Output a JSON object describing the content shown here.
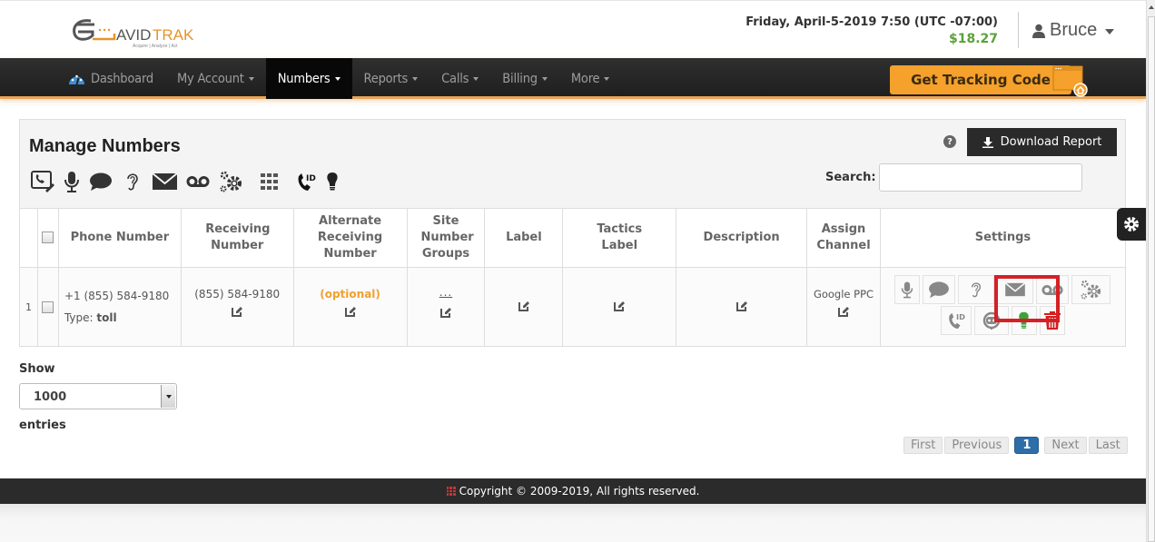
{
  "header": {
    "logo_text_dark": "AVID",
    "logo_text_orange": "TRAK",
    "logo_tagline": "Acquire  |  Analyze  |  Act",
    "datetime": "Friday, April-5-2019 7:50 (UTC -07:00)",
    "balance": "$18.27",
    "user_name": "Bruce",
    "user_icon": "user-icon"
  },
  "nav": {
    "items": [
      {
        "label": "Dashboard",
        "icon": "dashboard-gauge-icon",
        "dropdown": false,
        "active": false
      },
      {
        "label": "My Account",
        "dropdown": true,
        "active": false
      },
      {
        "label": "Numbers",
        "dropdown": true,
        "active": true
      },
      {
        "label": "Reports",
        "dropdown": true,
        "active": false
      },
      {
        "label": "Calls",
        "dropdown": true,
        "active": false
      },
      {
        "label": "Billing",
        "dropdown": true,
        "active": false
      },
      {
        "label": "More",
        "dropdown": true,
        "active": false
      }
    ],
    "tracking_button": "Get Tracking Code",
    "tracking_icon": "browser-home-icon"
  },
  "panel": {
    "title": "Manage Numbers",
    "toolbar_icons": [
      "call-edit-icon",
      "microphone-icon",
      "chat-bubble-icon",
      "ear-icon",
      "envelope-icon",
      "voicemail-icon",
      "gears-icon",
      "grid-icon",
      "caller-id-icon",
      "lightbulb-icon"
    ],
    "help_glyph": "?",
    "download_button": "Download Report",
    "search_label": "Search:",
    "search_value": "",
    "search_placeholder": ""
  },
  "table": {
    "columns": [
      "",
      "",
      "Phone Number",
      "Receiving Number",
      "Alternate Receiving Number",
      "Site Number Groups",
      "Label",
      "Tactics Label",
      "Description",
      "Assign Channel",
      "Settings"
    ],
    "rows": [
      {
        "index": "1",
        "phone_number": "+1 (855) 584-9180",
        "type_label": "Type: ",
        "type_value": "toll",
        "receiving_number": "(855) 584-9180",
        "alternate_receiving": "(optional)",
        "site_number_groups": "...",
        "label": "",
        "tactics_label": "",
        "description": "",
        "assign_channel": "Google PPC",
        "settings_row1": [
          "microphone-icon",
          "chat-bubble-icon",
          "ear-icon",
          "envelope-icon",
          "voicemail-icon",
          "gears-icon"
        ],
        "settings_row2": [
          "caller-id-icon",
          "robot-icon",
          "lightbulb-green-icon",
          "trash-icon"
        ],
        "highlighted_setting": "envelope-icon"
      }
    ]
  },
  "length": {
    "show_label": "Show",
    "selected": "1000",
    "entries_label": "entries"
  },
  "pagination": {
    "first": "First",
    "previous": "Previous",
    "current": "1",
    "next": "Next",
    "last": "Last"
  },
  "footer": {
    "text": "Copyright © 2009-2019, All rights reserved."
  },
  "colors": {
    "accent_orange": "#f5a12b",
    "balance_green": "#5aa13b",
    "nav_dark": "#222222",
    "highlight_red": "#d52026",
    "pager_blue": "#2d6da8"
  }
}
